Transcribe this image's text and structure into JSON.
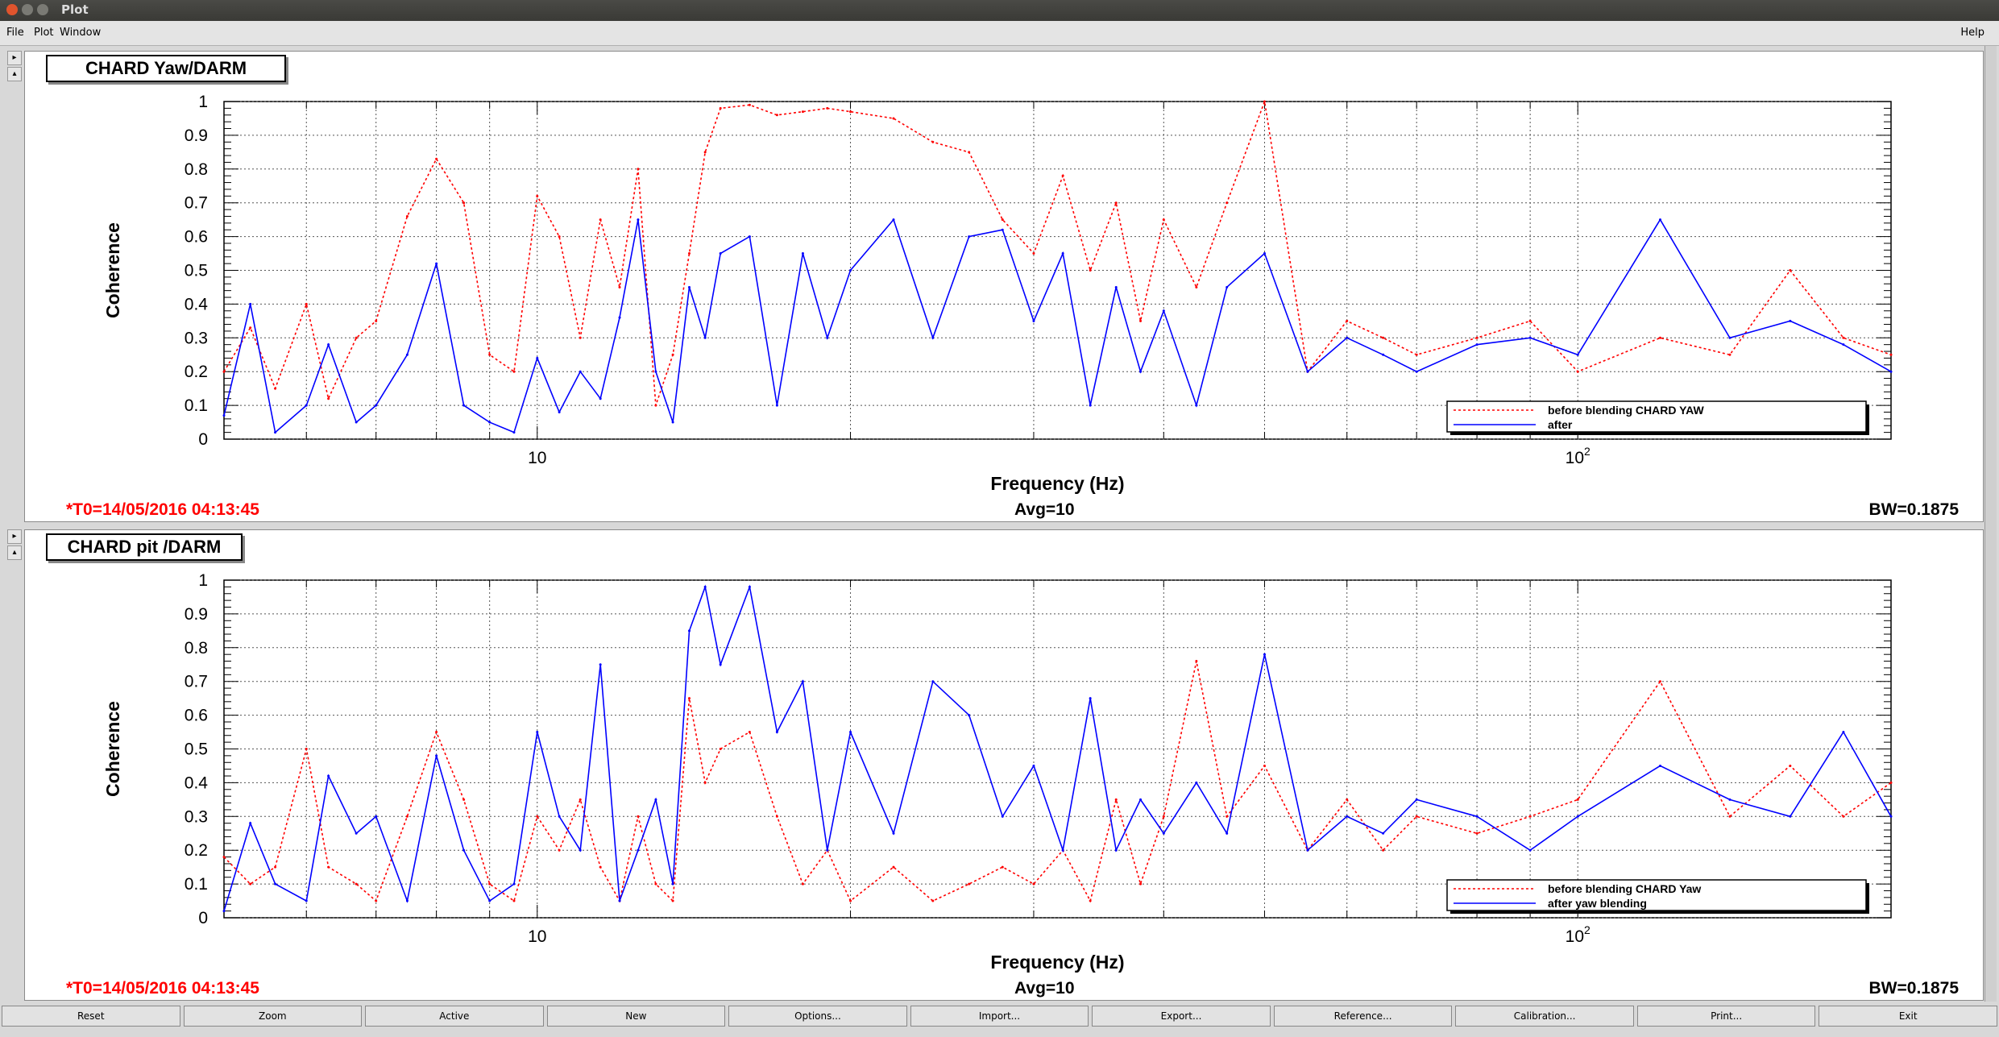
{
  "window": {
    "title": "Plot"
  },
  "menu": {
    "file": "File",
    "plot": "Plot",
    "window": "Window",
    "help": "Help"
  },
  "panels": [
    {
      "title": "CHARD Yaw/DARM",
      "t0": "*T0=14/05/2016 04:13:45",
      "avg": "Avg=10",
      "bw": "BW=0.1875",
      "legend": [
        "before blending CHARD YAW",
        "after"
      ]
    },
    {
      "title": "CHARD pit /DARM",
      "t0": "*T0=14/05/2016 04:13:45",
      "avg": "Avg=10",
      "bw": "BW=0.1875",
      "legend": [
        "before blending CHARD Yaw",
        "after yaw blending"
      ]
    }
  ],
  "buttons": [
    "Reset",
    "Zoom",
    "Active",
    "New",
    "Options...",
    "Import...",
    "Export...",
    "Reference...",
    "Calibration...",
    "Print...",
    "Exit"
  ],
  "colors": {
    "before": "#ff0000",
    "after": "#0000ff"
  },
  "chart_data": [
    {
      "type": "line",
      "title": "CHARD Yaw/DARM",
      "xlabel": "Frequency (Hz)",
      "ylabel": "Coherence",
      "xscale": "log",
      "xlim": [
        5,
        200
      ],
      "ylim": [
        0,
        1
      ],
      "x_tick_labels": [
        "10",
        "10^2"
      ],
      "y_ticks": [
        0,
        0.1,
        0.2,
        0.3,
        0.4,
        0.5,
        0.6,
        0.7,
        0.8,
        0.9,
        1
      ],
      "grid": true,
      "legend_position": "bottom-right",
      "series": [
        {
          "name": "before blending CHARD YAW",
          "style": "dotted",
          "color": "#ff0000",
          "x": [
            5,
            5.3,
            5.6,
            6,
            6.3,
            6.7,
            7,
            7.5,
            8,
            8.5,
            9,
            9.5,
            10,
            10.5,
            11,
            11.5,
            12,
            12.5,
            13,
            13.5,
            14,
            14.5,
            15,
            16,
            17,
            18,
            19,
            20,
            22,
            24,
            26,
            28,
            30,
            32,
            34,
            36,
            38,
            40,
            43,
            46,
            50,
            55,
            60,
            65,
            70,
            80,
            90,
            100,
            120,
            140,
            160,
            180,
            200
          ],
          "y": [
            0.2,
            0.33,
            0.15,
            0.4,
            0.12,
            0.3,
            0.35,
            0.66,
            0.83,
            0.7,
            0.25,
            0.2,
            0.72,
            0.6,
            0.3,
            0.65,
            0.45,
            0.8,
            0.1,
            0.25,
            0.55,
            0.85,
            0.98,
            0.99,
            0.96,
            0.97,
            0.98,
            0.97,
            0.95,
            0.88,
            0.85,
            0.65,
            0.55,
            0.78,
            0.5,
            0.7,
            0.35,
            0.65,
            0.45,
            0.7,
            1.0,
            0.2,
            0.35,
            0.3,
            0.25,
            0.3,
            0.35,
            0.2,
            0.3,
            0.25,
            0.5,
            0.3,
            0.25
          ]
        },
        {
          "name": "after",
          "style": "solid",
          "color": "#0000ff",
          "x": [
            5,
            5.3,
            5.6,
            6,
            6.3,
            6.7,
            7,
            7.5,
            8,
            8.5,
            9,
            9.5,
            10,
            10.5,
            11,
            11.5,
            12,
            12.5,
            13,
            13.5,
            14,
            14.5,
            15,
            16,
            17,
            18,
            19,
            20,
            22,
            24,
            26,
            28,
            30,
            32,
            34,
            36,
            38,
            40,
            43,
            46,
            50,
            55,
            60,
            65,
            70,
            80,
            90,
            100,
            120,
            140,
            160,
            180,
            200
          ],
          "y": [
            0.07,
            0.4,
            0.02,
            0.1,
            0.28,
            0.05,
            0.1,
            0.25,
            0.52,
            0.1,
            0.05,
            0.02,
            0.24,
            0.08,
            0.2,
            0.12,
            0.36,
            0.65,
            0.2,
            0.05,
            0.45,
            0.3,
            0.55,
            0.6,
            0.1,
            0.55,
            0.3,
            0.5,
            0.65,
            0.3,
            0.6,
            0.62,
            0.35,
            0.55,
            0.1,
            0.45,
            0.2,
            0.38,
            0.1,
            0.45,
            0.55,
            0.2,
            0.3,
            0.25,
            0.2,
            0.28,
            0.3,
            0.25,
            0.65,
            0.3,
            0.35,
            0.28,
            0.2
          ]
        }
      ]
    },
    {
      "type": "line",
      "title": "CHARD pit /DARM",
      "xlabel": "Frequency (Hz)",
      "ylabel": "Coherence",
      "xscale": "log",
      "xlim": [
        5,
        200
      ],
      "ylim": [
        0,
        1
      ],
      "x_tick_labels": [
        "10",
        "10^2"
      ],
      "y_ticks": [
        0,
        0.1,
        0.2,
        0.3,
        0.4,
        0.5,
        0.6,
        0.7,
        0.8,
        0.9,
        1
      ],
      "grid": true,
      "legend_position": "bottom-right",
      "series": [
        {
          "name": "before blending CHARD Yaw",
          "style": "dotted",
          "color": "#ff0000",
          "x": [
            5,
            5.3,
            5.6,
            6,
            6.3,
            6.7,
            7,
            7.5,
            8,
            8.5,
            9,
            9.5,
            10,
            10.5,
            11,
            11.5,
            12,
            12.5,
            13,
            13.5,
            14,
            14.5,
            15,
            16,
            17,
            18,
            19,
            20,
            22,
            24,
            26,
            28,
            30,
            32,
            34,
            36,
            38,
            40,
            43,
            46,
            50,
            55,
            60,
            65,
            70,
            80,
            90,
            100,
            120,
            140,
            160,
            180,
            200
          ],
          "y": [
            0.18,
            0.1,
            0.15,
            0.5,
            0.15,
            0.1,
            0.05,
            0.3,
            0.55,
            0.35,
            0.1,
            0.05,
            0.3,
            0.2,
            0.35,
            0.15,
            0.05,
            0.3,
            0.1,
            0.05,
            0.65,
            0.4,
            0.5,
            0.55,
            0.3,
            0.1,
            0.2,
            0.05,
            0.15,
            0.05,
            0.1,
            0.15,
            0.1,
            0.2,
            0.05,
            0.35,
            0.1,
            0.3,
            0.76,
            0.3,
            0.45,
            0.2,
            0.35,
            0.2,
            0.3,
            0.25,
            0.3,
            0.35,
            0.7,
            0.3,
            0.45,
            0.3,
            0.4
          ]
        },
        {
          "name": "after yaw blending",
          "style": "solid",
          "color": "#0000ff",
          "x": [
            5,
            5.3,
            5.6,
            6,
            6.3,
            6.7,
            7,
            7.5,
            8,
            8.5,
            9,
            9.5,
            10,
            10.5,
            11,
            11.5,
            12,
            12.5,
            13,
            13.5,
            14,
            14.5,
            15,
            16,
            17,
            18,
            19,
            20,
            22,
            24,
            26,
            28,
            30,
            32,
            34,
            36,
            38,
            40,
            43,
            46,
            50,
            55,
            60,
            65,
            70,
            80,
            90,
            100,
            120,
            140,
            160,
            180,
            200
          ],
          "y": [
            0.02,
            0.28,
            0.1,
            0.05,
            0.42,
            0.25,
            0.3,
            0.05,
            0.48,
            0.2,
            0.05,
            0.1,
            0.55,
            0.3,
            0.2,
            0.75,
            0.05,
            0.2,
            0.35,
            0.1,
            0.85,
            0.98,
            0.75,
            0.98,
            0.55,
            0.7,
            0.2,
            0.55,
            0.25,
            0.7,
            0.6,
            0.3,
            0.45,
            0.2,
            0.65,
            0.2,
            0.35,
            0.25,
            0.4,
            0.25,
            0.78,
            0.2,
            0.3,
            0.25,
            0.35,
            0.3,
            0.2,
            0.3,
            0.45,
            0.35,
            0.3,
            0.55,
            0.3
          ]
        }
      ]
    }
  ]
}
